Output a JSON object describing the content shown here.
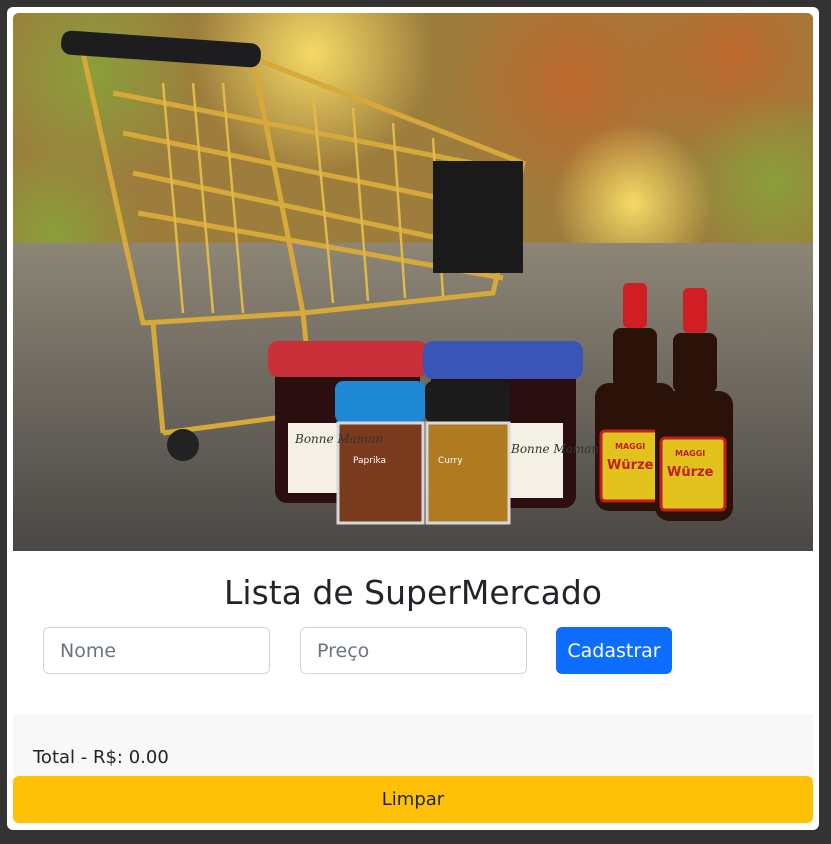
{
  "hero_image": {
    "alt_semantic": "shopping-cart-with-groceries-photo",
    "jar_labels": [
      "Bonne Maman",
      "Bonne Maman"
    ],
    "spice_labels": [
      "Paprika",
      "Curry"
    ],
    "bottle_labels": [
      "MAGGI",
      "Würze",
      "MAGGI",
      "Würze"
    ]
  },
  "title": "Lista de SuperMercado",
  "form": {
    "name_placeholder": "Nome",
    "name_value": "",
    "price_placeholder": "Preço",
    "price_value": "",
    "submit_label": "Cadastrar"
  },
  "footer": {
    "total_text": "Total - R$: 0.00",
    "clear_label": "Limpar"
  },
  "colors": {
    "primary": "#0d6efd",
    "warning": "#ffc107",
    "background": "#333333"
  }
}
